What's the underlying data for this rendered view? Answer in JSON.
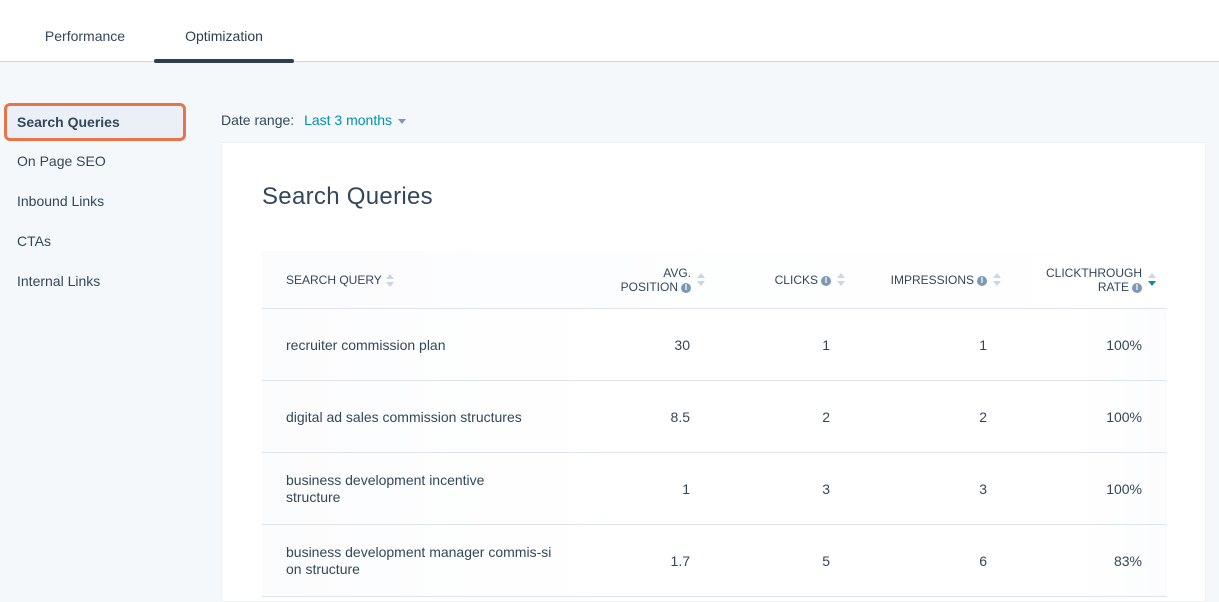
{
  "tabs": [
    {
      "label": "Performance",
      "active": false
    },
    {
      "label": "Optimization",
      "active": true
    }
  ],
  "sidebar": {
    "items": [
      {
        "label": "Search Queries",
        "active": true
      },
      {
        "label": "On Page SEO",
        "active": false
      },
      {
        "label": "Inbound Links",
        "active": false
      },
      {
        "label": "CTAs",
        "active": false
      },
      {
        "label": "Internal Links",
        "active": false
      }
    ]
  },
  "date_range": {
    "label": "Date range:",
    "value": "Last 3 months"
  },
  "card": {
    "title": "Search Queries"
  },
  "table": {
    "columns": [
      {
        "line1": "Search Query",
        "line2": "",
        "info": false,
        "sort": "none"
      },
      {
        "line1": "Avg.",
        "line2": "Position",
        "info": true,
        "sort": "none"
      },
      {
        "line1": "Clicks",
        "line2": "",
        "info": true,
        "sort": "none"
      },
      {
        "line1": "Impressions",
        "line2": "",
        "info": true,
        "sort": "none"
      },
      {
        "line1": "Clickthrough",
        "line2": "Rate",
        "info": true,
        "sort": "descending"
      }
    ],
    "rows": [
      {
        "query": "recruiter commission plan",
        "avg_position": "30",
        "clicks": "1",
        "impressions": "1",
        "ctr": "100%"
      },
      {
        "query": "digital ad sales commission structures",
        "avg_position": "8.5",
        "clicks": "2",
        "impressions": "2",
        "ctr": "100%"
      },
      {
        "query": "business development incentive structure",
        "avg_position": "1",
        "clicks": "3",
        "impressions": "3",
        "ctr": "100%"
      },
      {
        "query": "business development manager commis-sion structure",
        "avg_position": "1.7",
        "clicks": "5",
        "impressions": "6",
        "ctr": "83%"
      }
    ]
  },
  "colors": {
    "accent": "#0091ae",
    "active_outline": "#e8744a",
    "tab_indicator": "#2d3e50"
  }
}
